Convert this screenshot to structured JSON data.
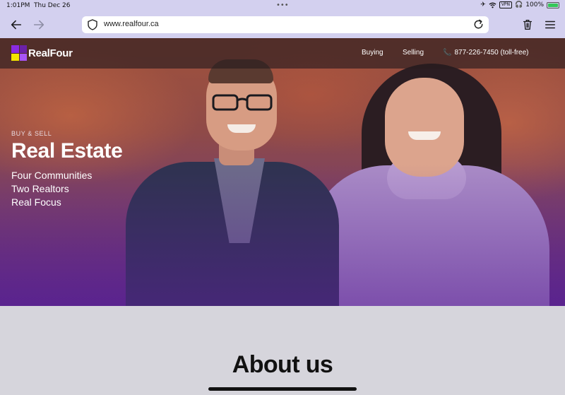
{
  "status": {
    "time": "1:01PM",
    "date": "Thu Dec 26",
    "battery": "100%",
    "vpn": "VPN"
  },
  "browser": {
    "url": "www.realfour.ca"
  },
  "site": {
    "logo": "RealFour",
    "nav": {
      "buying": "Buying",
      "selling": "Selling",
      "phone": "877-226-7450 (toll-free)"
    }
  },
  "hero": {
    "eyebrow": "BUY & SELL",
    "title": "Real Estate",
    "lines": [
      "Four Communities",
      "Two Realtors",
      "Real Focus"
    ]
  },
  "about": {
    "title": "About us"
  },
  "colors": {
    "accent_purple": "#8a2be2",
    "accent_yellow": "#f2e600",
    "toolbar": "#d3d0ef"
  }
}
